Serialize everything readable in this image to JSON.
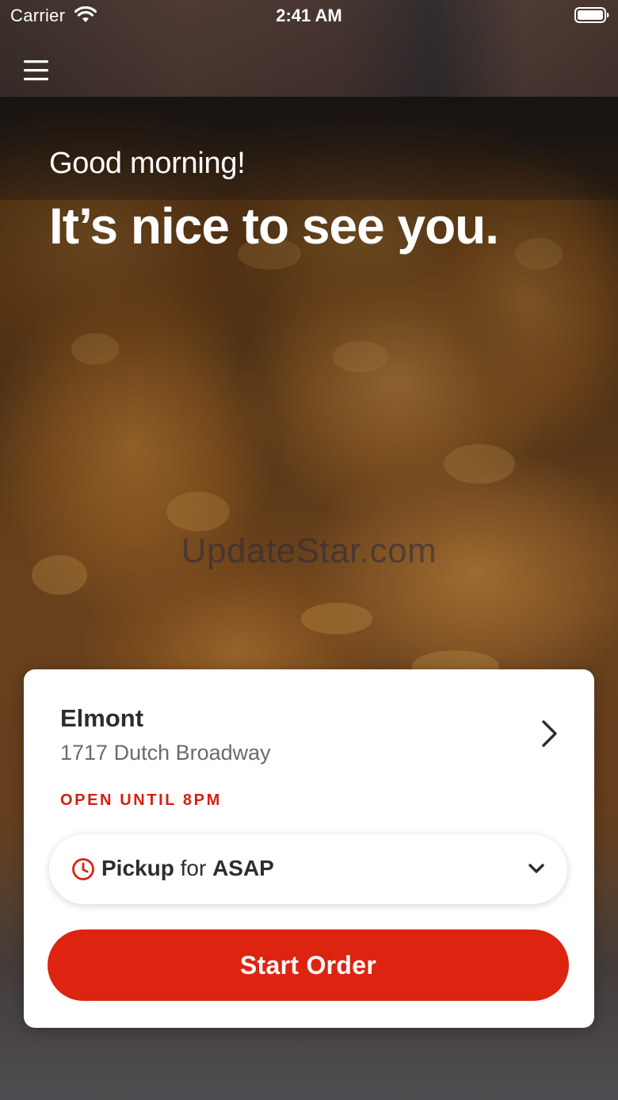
{
  "status_bar": {
    "carrier": "Carrier",
    "time": "2:41 AM",
    "wifi_icon": "wifi-icon",
    "battery_icon": "battery-icon"
  },
  "header": {
    "menu_icon": "hamburger-menu-icon"
  },
  "hero": {
    "greeting": "Good morning!",
    "headline": "It’s nice to see you.",
    "watermark": "UpdateStar.com"
  },
  "store_card": {
    "store_name": "Elmont",
    "address": "1717 Dutch Broadway",
    "hours": "OPEN UNTIL 8PM",
    "order_mode": {
      "icon": "clock-icon",
      "mode": "Pickup",
      "connector": "for",
      "time": "ASAP"
    },
    "start_order_label": "Start Order"
  },
  "colors": {
    "accent_red": "#dc2410",
    "hours_red": "#d42010",
    "text_dark": "#2d2d2d",
    "text_muted": "#6b6b6b"
  }
}
